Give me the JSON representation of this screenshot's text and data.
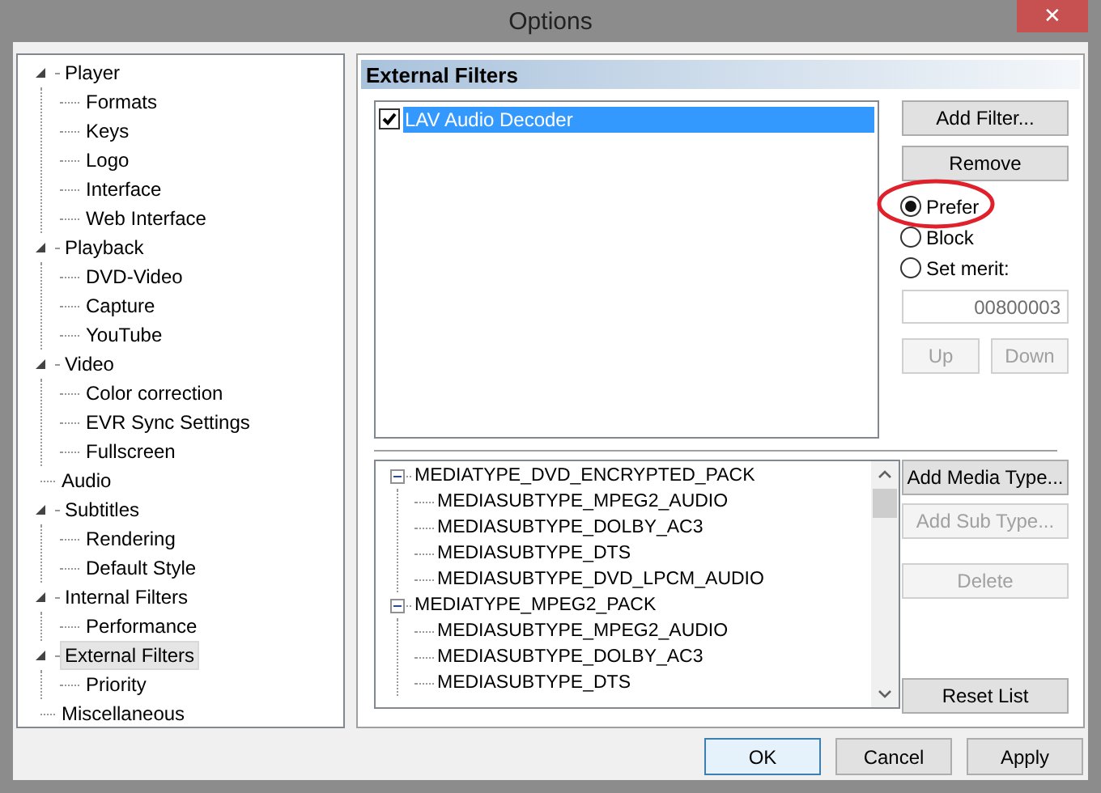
{
  "window": {
    "title": "Options",
    "close_label": "✕"
  },
  "nav_tree": [
    {
      "label": "Player",
      "expanded": true,
      "selected": false,
      "children": [
        {
          "label": "Formats",
          "selected": false
        },
        {
          "label": "Keys",
          "selected": false
        },
        {
          "label": "Logo",
          "selected": false
        },
        {
          "label": "Interface",
          "selected": false
        },
        {
          "label": "Web Interface",
          "selected": false
        }
      ]
    },
    {
      "label": "Playback",
      "expanded": true,
      "selected": false,
      "children": [
        {
          "label": "DVD-Video",
          "selected": false
        },
        {
          "label": "Capture",
          "selected": false
        },
        {
          "label": "YouTube",
          "selected": false
        }
      ]
    },
    {
      "label": "Video",
      "expanded": true,
      "selected": false,
      "children": [
        {
          "label": "Color correction",
          "selected": false
        },
        {
          "label": "EVR Sync Settings",
          "selected": false
        },
        {
          "label": "Fullscreen",
          "selected": false
        }
      ]
    },
    {
      "label": "Audio",
      "selected": false
    },
    {
      "label": "Subtitles",
      "expanded": true,
      "selected": false,
      "children": [
        {
          "label": "Rendering",
          "selected": false
        },
        {
          "label": "Default Style",
          "selected": false
        }
      ]
    },
    {
      "label": "Internal Filters",
      "expanded": true,
      "selected": false,
      "children": [
        {
          "label": "Performance",
          "selected": false
        }
      ]
    },
    {
      "label": "External Filters",
      "expanded": true,
      "selected": true,
      "children": [
        {
          "label": "Priority",
          "selected": false
        }
      ]
    },
    {
      "label": "Miscellaneous",
      "selected": false
    }
  ],
  "panel": {
    "title": "External Filters",
    "filters": [
      {
        "label": "LAV Audio Decoder",
        "checked": true,
        "selected": true
      }
    ],
    "filter_buttons": [
      {
        "label": "Add Filter...",
        "disabled": false
      },
      {
        "label": "Remove",
        "disabled": false
      }
    ],
    "merit_options": [
      {
        "label": "Prefer",
        "selected": true,
        "highlighted": true
      },
      {
        "label": "Block",
        "selected": false,
        "highlighted": false
      },
      {
        "label": "Set merit:",
        "selected": false,
        "highlighted": false
      }
    ],
    "merit_field": {
      "value": "00800003",
      "disabled": true
    },
    "order_buttons": [
      {
        "label": "Up",
        "disabled": true
      },
      {
        "label": "Down",
        "disabled": true
      }
    ],
    "media_types": [
      {
        "label": "MEDIATYPE_DVD_ENCRYPTED_PACK",
        "expanded": true,
        "children": [
          {
            "label": "MEDIASUBTYPE_MPEG2_AUDIO"
          },
          {
            "label": "MEDIASUBTYPE_DOLBY_AC3"
          },
          {
            "label": "MEDIASUBTYPE_DTS"
          },
          {
            "label": "MEDIASUBTYPE_DVD_LPCM_AUDIO"
          }
        ]
      },
      {
        "label": "MEDIATYPE_MPEG2_PACK",
        "expanded": true,
        "children": [
          {
            "label": "MEDIASUBTYPE_MPEG2_AUDIO"
          },
          {
            "label": "MEDIASUBTYPE_DOLBY_AC3"
          },
          {
            "label": "MEDIASUBTYPE_DTS"
          }
        ]
      }
    ],
    "media_buttons": [
      {
        "label": "Add Media Type...",
        "disabled": false,
        "kind": "first"
      },
      {
        "label": "Add Sub Type...",
        "disabled": true,
        "kind": "top"
      },
      {
        "label": "Delete",
        "disabled": true,
        "kind": "gap"
      },
      {
        "label": "Reset List",
        "disabled": false,
        "kind": "bottom"
      }
    ]
  },
  "dialog_buttons": [
    {
      "label": "OK",
      "default": true
    },
    {
      "label": "Cancel",
      "default": false
    },
    {
      "label": "Apply",
      "default": false
    }
  ]
}
